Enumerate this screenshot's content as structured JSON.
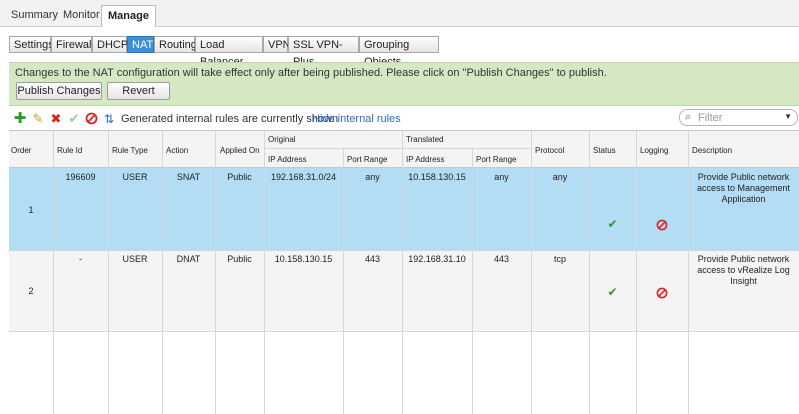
{
  "top_tabs": [
    "Summary",
    "Monitor",
    "Manage"
  ],
  "sub_tabs": [
    "Settings",
    "Firewall",
    "DHCP",
    "NAT",
    "Routing",
    "Load Balancer",
    "VPN",
    "SSL VPN-Plus",
    "Grouping Objects"
  ],
  "banner": {
    "message": "Changes to the NAT configuration will take effect only after being published. Please click on \"Publish Changes\" to publish.",
    "publish_label": "Publish Changes",
    "revert_label": "Revert"
  },
  "toolbar": {
    "internal_text": "Generated internal rules are currently shown",
    "hide_link": "Hide internal rules",
    "filter_placeholder": "Filter"
  },
  "table": {
    "headers": {
      "order": "Order",
      "rule_id": "Rule Id",
      "rule_type": "Rule Type",
      "action": "Action",
      "applied_on": "Applied On",
      "original": "Original",
      "translated": "Translated",
      "ip_address": "IP Address",
      "port_range": "Port Range",
      "protocol": "Protocol",
      "status": "Status",
      "logging": "Logging",
      "description": "Description"
    },
    "rows": [
      {
        "order": "1",
        "rule_id": "196609",
        "rule_type": "USER",
        "action": "SNAT",
        "applied_on": "Public",
        "orig_ip": "192.168.31.0/24",
        "orig_port": "any",
        "trans_ip": "10.158.130.15",
        "trans_port": "any",
        "protocol": "any",
        "description": [
          "Provide Public network",
          "access to Management",
          "Application"
        ]
      },
      {
        "order": "2",
        "rule_id": "-",
        "rule_type": "USER",
        "action": "DNAT",
        "applied_on": "Public",
        "orig_ip": "10.158.130.15",
        "orig_port": "443",
        "trans_ip": "192.168.31.10",
        "trans_port": "443",
        "protocol": "tcp",
        "description": [
          "Provide Public network",
          "access to vRealize Log",
          "Insight"
        ]
      }
    ]
  },
  "colors": {
    "selected_row": "#b3dcf5",
    "banner": "#d4e8c4",
    "active_tab": "#3d8fd6",
    "link": "#2a6ebb"
  },
  "icons": [
    "add-icon",
    "edit-icon",
    "delete-icon",
    "enable-icon",
    "disable-icon",
    "move-icon",
    "search-icon",
    "check-icon",
    "blocked-icon"
  ]
}
